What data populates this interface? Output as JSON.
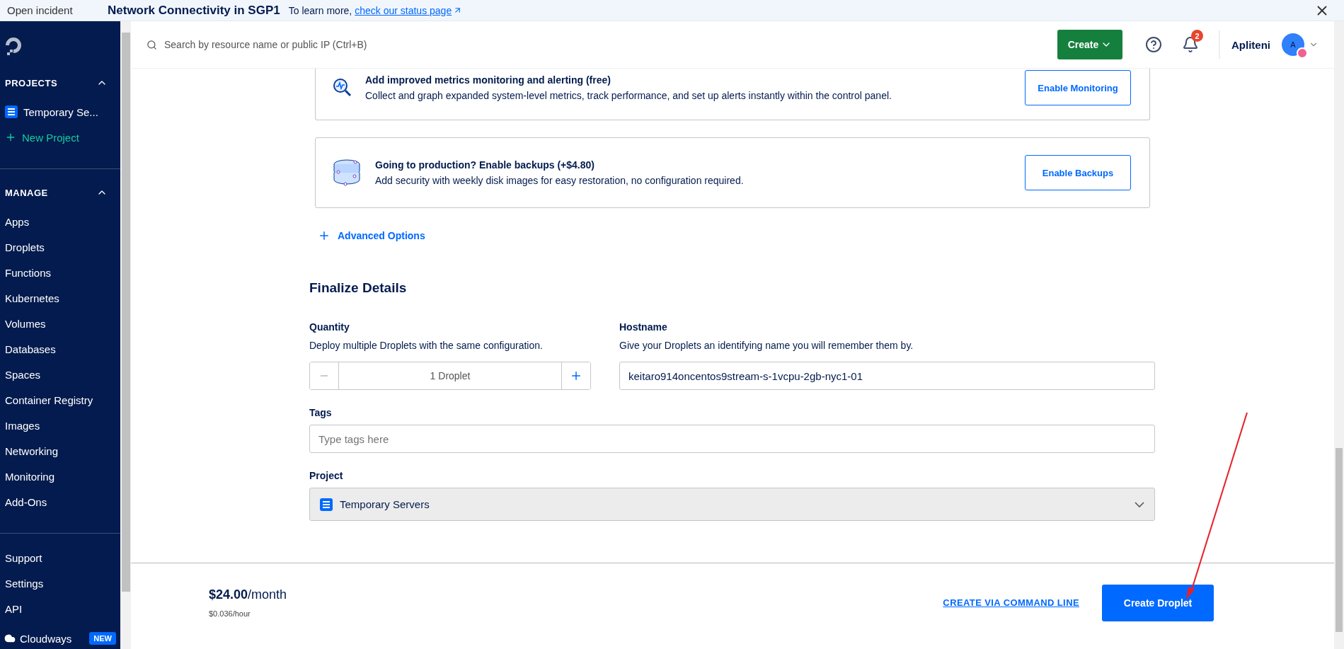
{
  "banner": {
    "label": "Open incident",
    "title": "Network Connectivity in SGP1",
    "text": "To learn more,",
    "link": "check our status page"
  },
  "sidebar": {
    "sections": [
      {
        "heading": "PROJECTS",
        "expanded": true,
        "items": [
          {
            "label": "Temporary Se...",
            "kind": "project"
          },
          {
            "label": "New Project",
            "kind": "add"
          }
        ]
      },
      {
        "heading": "MANAGE",
        "expanded": true,
        "items": [
          {
            "label": "Apps",
            "kind": "link"
          },
          {
            "label": "Droplets",
            "kind": "link"
          },
          {
            "label": "Functions",
            "kind": "link"
          },
          {
            "label": "Kubernetes",
            "kind": "link"
          },
          {
            "label": "Volumes",
            "kind": "link"
          },
          {
            "label": "Databases",
            "kind": "link"
          },
          {
            "label": "Spaces",
            "kind": "link"
          },
          {
            "label": "Container Registry",
            "kind": "link"
          },
          {
            "label": "Images",
            "kind": "link"
          },
          {
            "label": "Networking",
            "kind": "link"
          },
          {
            "label": "Monitoring",
            "kind": "link"
          },
          {
            "label": "Add-Ons",
            "kind": "link"
          }
        ]
      }
    ],
    "footer_items": [
      "Support",
      "Settings",
      "API"
    ],
    "promo": {
      "label": "Cloudways",
      "badge": "NEW"
    }
  },
  "header": {
    "search_placeholder": "Search by resource name or public IP (Ctrl+B)",
    "create_button": "Create",
    "notification_count": "2",
    "user_name": "Apliteni",
    "avatar_initial": "A"
  },
  "cards": [
    {
      "kind": "monitoring",
      "title": "Add improved metrics monitoring and alerting (free)",
      "description": "Collect and graph expanded system-level metrics, track performance, and set up alerts instantly within the control panel.",
      "button": "Enable Monitoring"
    },
    {
      "kind": "backups",
      "title": "Going to production? Enable backups (+$4.80)",
      "description": "Add security with weekly disk images for easy restoration, no configuration required.",
      "button": "Enable Backups"
    }
  ],
  "advanced_options": "Advanced Options",
  "finalize": {
    "title": "Finalize Details",
    "quantity": {
      "label": "Quantity",
      "description": "Deploy multiple Droplets with the same configuration.",
      "value": "1 Droplet"
    },
    "hostname": {
      "label": "Hostname",
      "description": "Give your Droplets an identifying name you will remember them by.",
      "value": "keitaro914oncentos9stream-s-1vcpu-2gb-nyc1-01"
    },
    "tags": {
      "label": "Tags",
      "placeholder": "Type tags here"
    },
    "project": {
      "label": "Project",
      "value": "Temporary Servers"
    }
  },
  "footer": {
    "price": "**$24.00**/month",
    "hourly": "$0.036/hour",
    "cli_link": "CREATE VIA COMMAND LINE",
    "create_button": "Create Droplet"
  }
}
